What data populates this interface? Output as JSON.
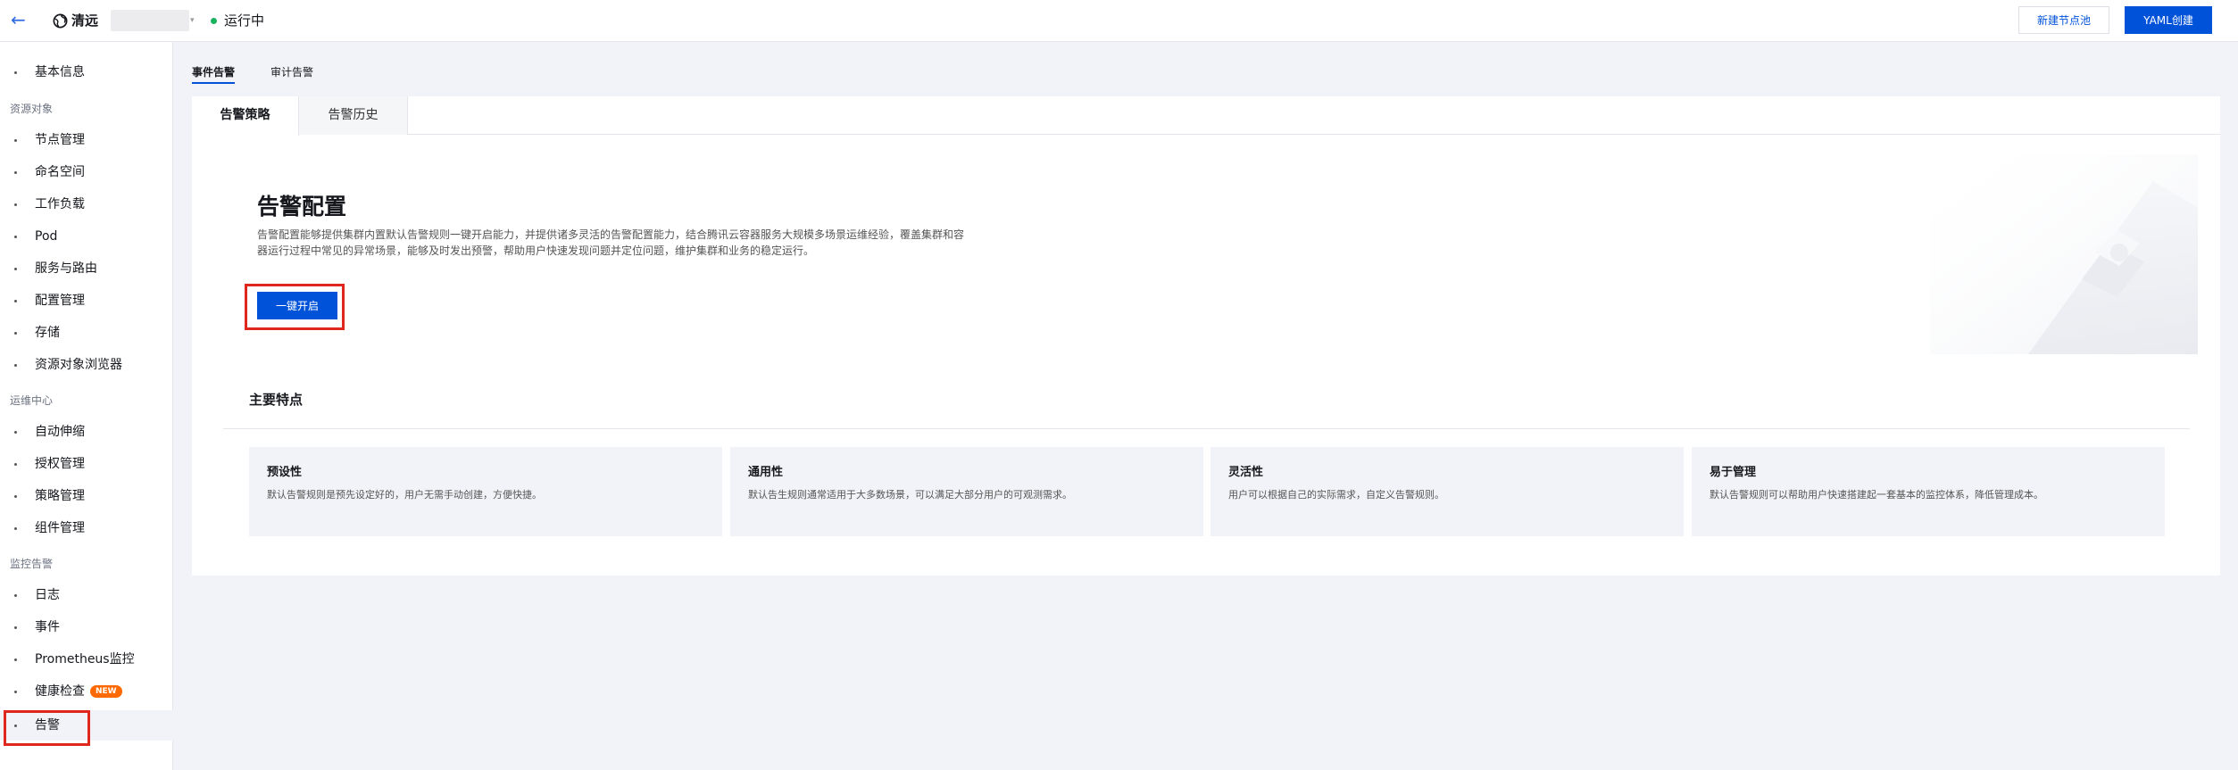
{
  "topbar": {
    "cluster_name": "清远",
    "status": "运行中",
    "new_node_pool": "新建节点池",
    "yaml_create": "YAML创建",
    "colors": {
      "primary": "#0052d9",
      "status": "#19b360"
    }
  },
  "sidebar": {
    "basic_info": "基本信息",
    "groups": {
      "resources": "资源对象",
      "ops": "运维中心",
      "monitoring": "监控告警"
    },
    "items": {
      "nodes": "节点管理",
      "namespaces": "命名空间",
      "workloads": "工作负载",
      "pod": "Pod",
      "services": "服务与路由",
      "config": "配置管理",
      "storage": "存储",
      "browser": "资源对象浏览器",
      "autoscale": "自动伸缩",
      "auth": "授权管理",
      "policy": "策略管理",
      "addons": "组件管理",
      "logs": "日志",
      "events": "事件",
      "prometheus": "Prometheus监控",
      "health": "健康检查",
      "alarm": "告警"
    },
    "new_badge": "NEW"
  },
  "subtabs": {
    "event_alarm": "事件告警",
    "audit_alarm": "审计告警"
  },
  "inner_tabs": {
    "policy": "告警策略",
    "history": "告警历史"
  },
  "hero": {
    "title": "告警配置",
    "description": "告警配置能够提供集群内置默认告警规则一键开启能力，并提供诸多灵活的告警配置能力，结合腾讯云容器服务大规模多场景运维经验，覆盖集群和容器运行过程中常见的异常场景，能够及时发出预警，帮助用户快速发现问题并定位问题，维护集群和业务的稳定运行。",
    "enable_button": "一键开启"
  },
  "features": {
    "title": "主要特点",
    "items": [
      {
        "title": "预设性",
        "desc": "默认告警规则是预先设定好的，用户无需手动创建，方便快捷。"
      },
      {
        "title": "通用性",
        "desc": "默认告生规则通常适用于大多数场景，可以满足大部分用户的可观测需求。"
      },
      {
        "title": "灵活性",
        "desc": "用户可以根据自己的实际需求，自定义告警规则。"
      },
      {
        "title": "易于管理",
        "desc": "默认告警规则可以帮助用户快速搭建起一套基本的监控体系，降低管理成本。"
      }
    ]
  }
}
